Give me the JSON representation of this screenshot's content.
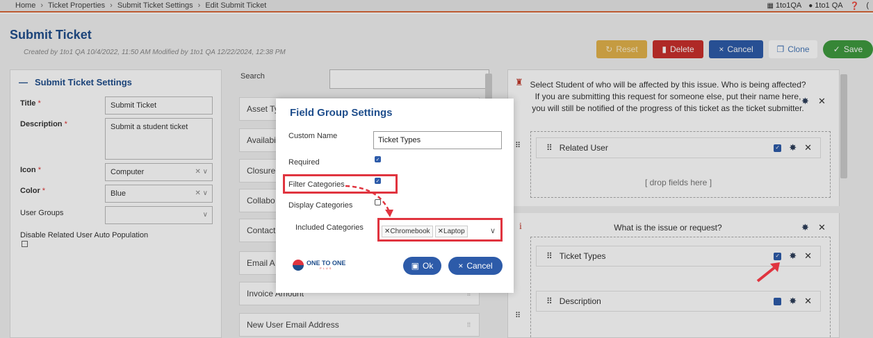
{
  "breadcrumb": [
    "Home",
    "Ticket Properties",
    "Submit Ticket Settings",
    "Edit Submit Ticket"
  ],
  "topright": {
    "org": "1to1QA",
    "user": "1to1 QA",
    "extra": "("
  },
  "header": {
    "title": "Submit Ticket",
    "meta": "Created by 1to1 QA 10/4/2022, 11:50 AM   Modified by 1to1 QA 12/22/2024, 12:38 PM",
    "buttons": {
      "reset": "Reset",
      "delete": "Delete",
      "cancel": "Cancel",
      "clone": "Clone",
      "save": "Save"
    }
  },
  "settings": {
    "heading": "Submit Ticket Settings",
    "title_label": "Title",
    "title_value": "Submit Ticket",
    "desc_label": "Description",
    "desc_value": "Submit a student ticket",
    "icon_label": "Icon",
    "icon_value": "Computer",
    "color_label": "Color",
    "color_value": "Blue",
    "groups_label": "User Groups",
    "disable_label": "Disable Related User Auto Population"
  },
  "fields": {
    "search_label": "Search",
    "items": [
      "Asset Ty",
      "Availabi",
      "Closure",
      "Collabo",
      "Contact",
      "Email A",
      "Invoice Amount",
      "New User Email Address"
    ]
  },
  "right": {
    "block1_text": "Select Student of who will be affected by this issue. Who is being affected? If you are submitting this request for someone else, put their name here, you will still be notified of the progress of this ticket as the ticket submitter.",
    "related_user": "Related User",
    "drop": "[ drop fields here ]",
    "block2_text": "What is the issue or request?",
    "ticket_types": "Ticket Types",
    "description": "Description"
  },
  "modal": {
    "title": "Field Group Settings",
    "custom_name_label": "Custom Name",
    "custom_name_value": "Ticket Types",
    "required_label": "Required",
    "filter_label": "Filter Categories",
    "display_label": "Display Categories",
    "included_label": "Included Categories",
    "included_tags": [
      "Chromebook",
      "Laptop"
    ],
    "logo_text": "ONE TO ONE",
    "logo_sub": "PLUS",
    "ok": "Ok",
    "cancel": "Cancel"
  },
  "colors": {
    "primary": "#2d5ba9",
    "title_blue": "#1f4e8c",
    "danger": "#c9302c",
    "warning": "#e3b34b",
    "success": "#3e9a3e",
    "highlight": "#e0343f"
  }
}
